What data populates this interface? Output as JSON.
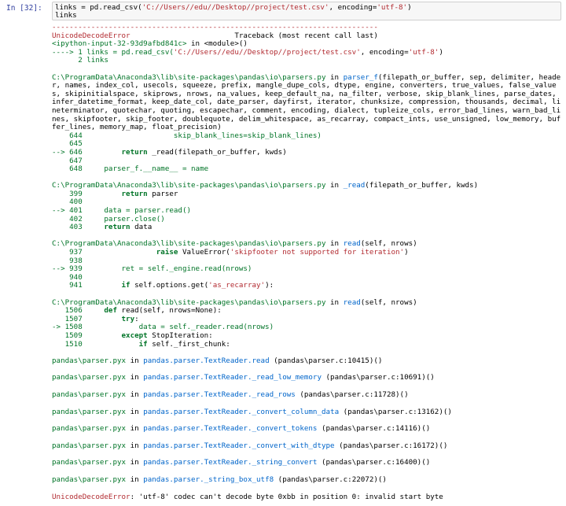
{
  "prompt": "In [32]:",
  "input": {
    "line1_a": "links = pd.read_csv(",
    "line1_str": "'C://Users//edu//Desktop//project/test.csv'",
    "line1_b": ", encoding=",
    "line1_enc": "'utf-8'",
    "line1_c": ")",
    "line2": "links"
  },
  "traceback": {
    "dashes": "---------------------------------------------------------------------------",
    "error_name": "UnicodeDecodeError",
    "header_right": "                        Traceback (most recent call last)",
    "ipython_loc": "<ipython-input-32-93d9afbd841c>",
    "in_module": " in <module>()",
    "arrow1_a": "----> 1 links = pd.read_csv(",
    "arrow1_str": "'C://Users//edu//Desktop//project/test.csv'",
    "arrow1_b": ", encoding=",
    "arrow1_enc": "'utf-8'",
    "arrow1_c": ")",
    "line2": "      2 links",
    "f1_path": "C:\\ProgramData\\Anaconda3\\lib\\site-packages\\pandas\\io\\parsers.py",
    "f1_in": " in ",
    "f1_func": "parser_f",
    "f1_sig": "(filepath_or_buffer, sep, delimiter, header, names, index_col, usecols, squeeze, prefix, mangle_dupe_cols, dtype, engine, converters, true_values, false_values, skipinitialspace, skiprows, nrows, na_values, keep_default_na, na_filter, verbose, skip_blank_lines, parse_dates, infer_datetime_format, keep_date_col, date_parser, dayfirst, iterator, chunksize, compression, thousands, decimal, lineterminator, quotechar, quoting, escapechar, comment, encoding, dialect, tupleize_cols, error_bad_lines, warn_bad_lines, skipfooter, skip_footer, doublequote, delim_whitespace, as_recarray, compact_ints, use_unsigned, low_memory, buffer_lines, memory_map, float_precision)",
    "f1_l644": "    644                     skip_blank_lines=skip_blank_lines)",
    "f1_l645": "    645 ",
    "f1_l646a": "--> 646         ",
    "f1_l646kw": "return",
    "f1_l646b": " _read(filepath_or_buffer, kwds)",
    "f1_l647": "    647 ",
    "f1_l648": "    648     parser_f.__name__ = name",
    "f2_path": "C:\\ProgramData\\Anaconda3\\lib\\site-packages\\pandas\\io\\parsers.py",
    "f2_in": " in ",
    "f2_func": "_read",
    "f2_sig": "(filepath_or_buffer, kwds)",
    "f2_l399a": "    399         ",
    "f2_l399kw": "return",
    "f2_l399b": " parser",
    "f2_l400": "    400 ",
    "f2_l401": "--> 401     data = parser.read()",
    "f2_l402": "    402     parser.close()",
    "f2_l403a": "    403     ",
    "f2_l403kw": "return",
    "f2_l403b": " data",
    "f3_path": "C:\\ProgramData\\Anaconda3\\lib\\site-packages\\pandas\\io\\parsers.py",
    "f3_in": " in ",
    "f3_func": "read",
    "f3_sig": "(self, nrows)",
    "f3_l937a": "    937                 ",
    "f3_l937kw": "raise",
    "f3_l937b": " ValueError(",
    "f3_l937str": "'skipfooter not supported for iteration'",
    "f3_l937c": ")",
    "f3_l938": "    938 ",
    "f3_l939": "--> 939         ret = self._engine.read(nrows)",
    "f3_l940": "    940 ",
    "f3_l941a": "    941         ",
    "f3_l941kw": "if",
    "f3_l941b": " self.options.get(",
    "f3_l941str": "'as_recarray'",
    "f3_l941c": "):",
    "f4_path": "C:\\ProgramData\\Anaconda3\\lib\\site-packages\\pandas\\io\\parsers.py",
    "f4_in": " in ",
    "f4_func": "read",
    "f4_sig": "(self, nrows)",
    "f4_l1506a": "   1506     ",
    "f4_l1506kw": "def",
    "f4_l1506b": " read(self, nrows=None):",
    "f4_l1507a": "   1507         ",
    "f4_l1507kw": "try",
    "f4_l1507b": ":",
    "f4_l1508": "-> 1508             data = self._reader.read(nrows)",
    "f4_l1509a": "   1509         ",
    "f4_l1509kw": "except",
    "f4_l1509b": " StopIteration:",
    "f4_l1510a": "   1510             ",
    "f4_l1510kw": "if",
    "f4_l1510b": " self._first_chunk:",
    "pyx": [
      {
        "file": "pandas\\parser.pyx",
        "in": " in ",
        "func": "pandas.parser.TextReader.read",
        "loc": " (pandas\\parser.c:10415)()"
      },
      {
        "file": "pandas\\parser.pyx",
        "in": " in ",
        "func": "pandas.parser.TextReader._read_low_memory",
        "loc": " (pandas\\parser.c:10691)()"
      },
      {
        "file": "pandas\\parser.pyx",
        "in": " in ",
        "func": "pandas.parser.TextReader._read_rows",
        "loc": " (pandas\\parser.c:11728)()"
      },
      {
        "file": "pandas\\parser.pyx",
        "in": " in ",
        "func": "pandas.parser.TextReader._convert_column_data",
        "loc": " (pandas\\parser.c:13162)()"
      },
      {
        "file": "pandas\\parser.pyx",
        "in": " in ",
        "func": "pandas.parser.TextReader._convert_tokens",
        "loc": " (pandas\\parser.c:14116)()"
      },
      {
        "file": "pandas\\parser.pyx",
        "in": " in ",
        "func": "pandas.parser.TextReader._convert_with_dtype",
        "loc": " (pandas\\parser.c:16172)()"
      },
      {
        "file": "pandas\\parser.pyx",
        "in": " in ",
        "func": "pandas.parser.TextReader._string_convert",
        "loc": " (pandas\\parser.c:16400)()"
      },
      {
        "file": "pandas\\parser.pyx",
        "in": " in ",
        "func": "pandas.parser._string_box_utf8",
        "loc": " (pandas\\parser.c:22072)()"
      }
    ],
    "final_error": "UnicodeDecodeError",
    "final_msg": ": 'utf-8' codec can't decode byte 0xbb in position 0: invalid start byte"
  }
}
